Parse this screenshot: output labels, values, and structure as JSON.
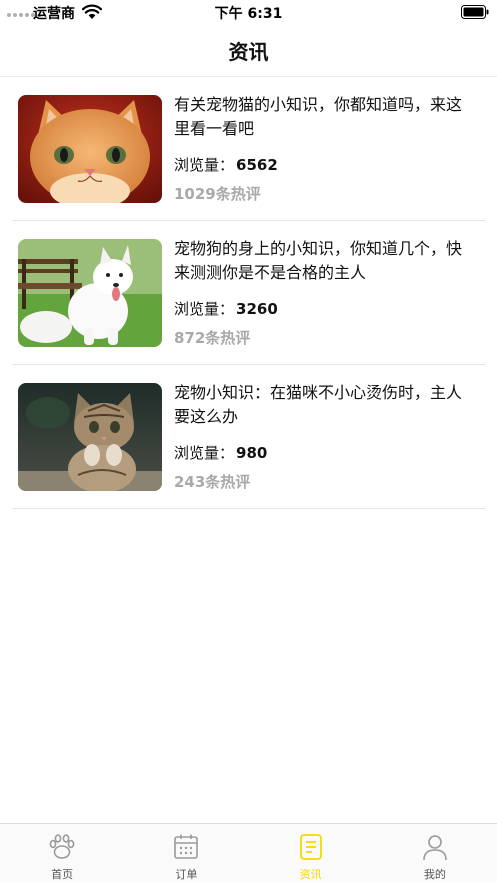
{
  "status_bar": {
    "carrier": "运营商",
    "time": "下午 6:31"
  },
  "nav": {
    "title": "资讯"
  },
  "articles": [
    {
      "title": "有关宠物猫的小知识，你都知道吗，来这里看一看吧",
      "views_label": "浏览量：",
      "views": "6562",
      "comments": "1029条热评",
      "thumbnail": "orange-kitten"
    },
    {
      "title": "宠物狗的身上的小知识，你知道几个，快来测测你是不是合格的主人",
      "views_label": "浏览量：",
      "views": "3260",
      "comments": "872条热评",
      "thumbnail": "white-samoyed-dog"
    },
    {
      "title": "宠物小知识：在猫咪不小心烫伤时，主人要这么办",
      "views_label": "浏览量：",
      "views": "980",
      "comments": "243条热评",
      "thumbnail": "tabby-kitten"
    }
  ],
  "tab_bar": {
    "active_color": "#f5d800",
    "tabs": [
      {
        "label": "首页",
        "icon": "paw-icon"
      },
      {
        "label": "订单",
        "icon": "calendar-icon"
      },
      {
        "label": "资讯",
        "icon": "document-icon"
      },
      {
        "label": "我的",
        "icon": "user-icon"
      }
    ]
  }
}
